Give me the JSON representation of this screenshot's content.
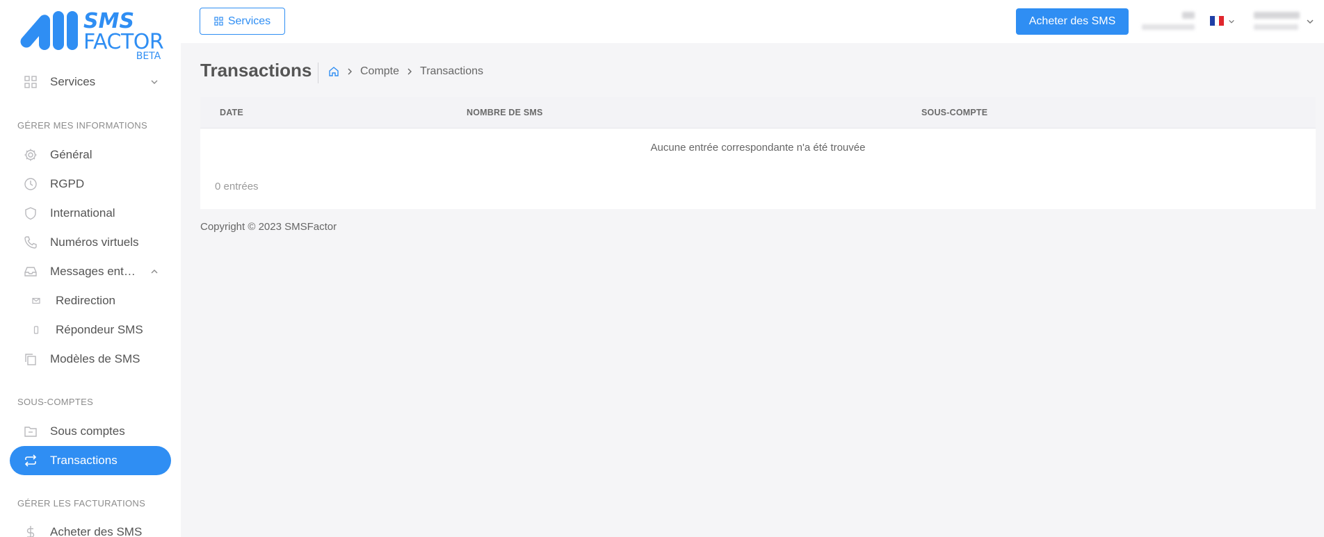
{
  "logo": {
    "line1": "SMS",
    "line2": "FACTOR",
    "line3": "BETA"
  },
  "colors": {
    "accent": "#2f8ef3",
    "background": "#f5f5f7",
    "sidebar": "#ffffff"
  },
  "sidebar": {
    "services": {
      "label": "Services",
      "icon": "grid-icon"
    },
    "sections": [
      {
        "title": "GÉRER MES INFORMATIONS"
      },
      {
        "title": "SOUS-COMPTES"
      },
      {
        "title": "GÉRER LES FACTURATIONS"
      }
    ],
    "items": [
      {
        "label": "Général",
        "icon": "gear-icon"
      },
      {
        "label": "RGPD",
        "icon": "clock-icon"
      },
      {
        "label": "International",
        "icon": "shield-icon"
      },
      {
        "label": "Numéros virtuels",
        "icon": "phone-icon"
      },
      {
        "label": "Messages entrants",
        "icon": "inbox-icon"
      },
      {
        "label": "Redirection",
        "icon": "mail-icon"
      },
      {
        "label": "Répondeur SMS",
        "icon": "mobile-icon"
      },
      {
        "label": "Modèles de SMS",
        "icon": "copy-icon"
      },
      {
        "label": "Sous comptes",
        "icon": "folder-icon"
      },
      {
        "label": "Transactions",
        "icon": "repeat-icon",
        "active": true
      },
      {
        "label": "Acheter des SMS",
        "icon": "dollar-icon"
      }
    ]
  },
  "topbar": {
    "services_label": "Services",
    "buy_label": "Acheter des SMS",
    "language": "fr"
  },
  "page": {
    "title": "Transactions",
    "breadcrumb": [
      "Compte",
      "Transactions"
    ]
  },
  "table": {
    "columns": [
      "DATE",
      "NOMBRE DE SMS",
      "SOUS-COMPTE"
    ],
    "empty_message": "Aucune entrée correspondante n'a été trouvée",
    "entries_info": "0 entrées"
  },
  "footer": {
    "copyright": "Copyright © 2023 SMSFactor"
  }
}
